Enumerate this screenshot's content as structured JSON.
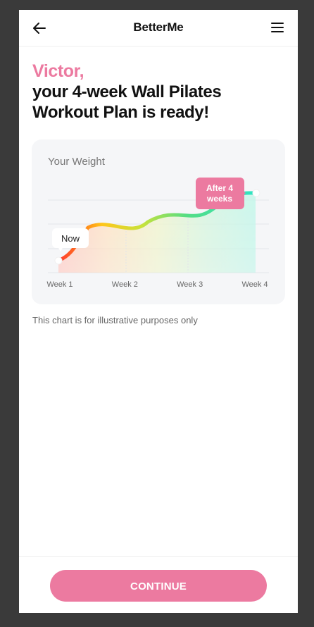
{
  "header": {
    "brand": "BetterMe",
    "back_icon": "arrow-left-icon",
    "menu_icon": "hamburger-menu-icon"
  },
  "headline": {
    "name": "Victor,",
    "title": "your 4-week Wall Pilates Workout Plan is ready!"
  },
  "chart_card": {
    "title": "Your Weight",
    "now_label": "Now",
    "after_label_line1": "After 4",
    "after_label_line2": "weeks"
  },
  "chart_data": {
    "type": "area",
    "title": "Your Weight",
    "categories": [
      "Week 1",
      "Week 2",
      "Week 3",
      "Week 4"
    ],
    "grid": true,
    "annotations": [
      "Now",
      "After 4 weeks"
    ]
  },
  "disclaimer": "This chart is for illustrative purposes only",
  "footer": {
    "continue_label": "CONTINUE"
  },
  "colors": {
    "accent": "#ec7aa0",
    "background": "#3a3a3a",
    "card": "#f5f6f8"
  }
}
